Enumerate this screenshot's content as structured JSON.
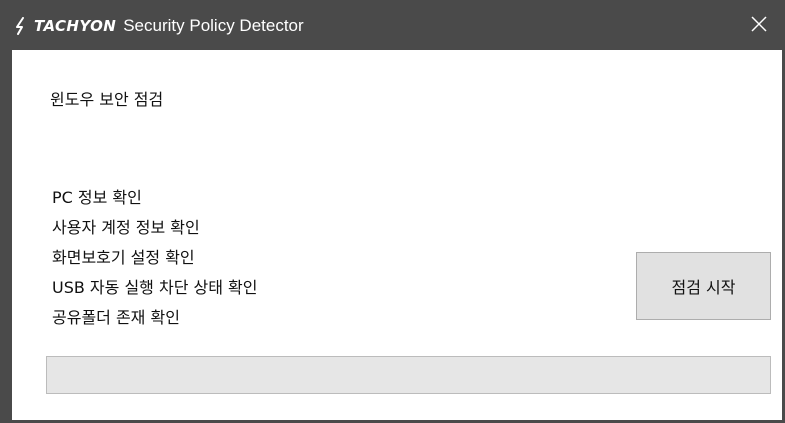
{
  "window": {
    "logo_text": "TACHYON",
    "title": "Security Policy Detector",
    "close_label": "✕"
  },
  "main": {
    "section_title": "윈도우 보안 점검",
    "checks": [
      "PC 정보 확인",
      "사용자 계정 정보 확인",
      "화면보호기 설정 확인",
      "USB 자동 실행 차단 상태 확인",
      "공유폴더 존재 확인"
    ],
    "start_button_label": "점검 시작",
    "progress": 0
  },
  "colors": {
    "titlebar": "#4a4a4a",
    "button_bg": "#e1e1e1",
    "progress_track": "#e6e6e6"
  },
  "icons": {
    "logo": "tachyon-logo-icon",
    "close": "close-icon"
  }
}
